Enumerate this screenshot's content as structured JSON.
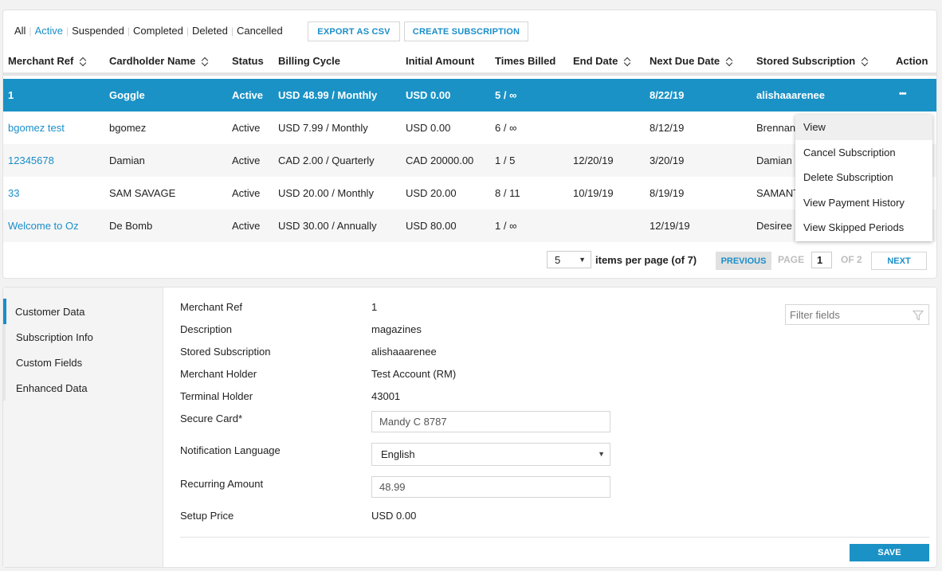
{
  "filters": [
    {
      "label": "All",
      "active": false
    },
    {
      "label": "Active",
      "active": true
    },
    {
      "label": "Suspended",
      "active": false
    },
    {
      "label": "Completed",
      "active": false
    },
    {
      "label": "Deleted",
      "active": false
    },
    {
      "label": "Cancelled",
      "active": false
    }
  ],
  "toolbar": {
    "export_label": "EXPORT AS CSV",
    "create_label": "CREATE SUBSCRIPTION"
  },
  "table": {
    "columns": [
      {
        "label": "Merchant Ref",
        "sortable": true
      },
      {
        "label": "Cardholder Name",
        "sortable": true
      },
      {
        "label": "Status",
        "sortable": false
      },
      {
        "label": "Billing Cycle",
        "sortable": false
      },
      {
        "label": "Initial Amount",
        "sortable": false
      },
      {
        "label": "Times Billed",
        "sortable": false
      },
      {
        "label": "End Date",
        "sortable": true
      },
      {
        "label": "Next Due Date",
        "sortable": true
      },
      {
        "label": "Stored Subscription",
        "sortable": true
      },
      {
        "label": "Action",
        "sortable": false
      }
    ],
    "rows": [
      {
        "merchant_ref": "1",
        "cardholder": "Goggle",
        "status": "Active",
        "billing_cycle": "USD 48.99 / Monthly",
        "initial_amount": "USD 0.00",
        "times_billed": "5 / ∞",
        "end_date": "",
        "next_due": "8/22/19",
        "stored_subscription": "alishaaarenee",
        "selected": true
      },
      {
        "merchant_ref": "bgomez test",
        "cardholder": "bgomez",
        "status": "Active",
        "billing_cycle": "USD 7.99 / Monthly",
        "initial_amount": "USD 0.00",
        "times_billed": "6 / ∞",
        "end_date": "",
        "next_due": "8/12/19",
        "stored_subscription": "Brennan"
      },
      {
        "merchant_ref": "12345678",
        "cardholder": "Damian",
        "status": "Active",
        "billing_cycle": "CAD 2.00 / Quarterly",
        "initial_amount": "CAD 20000.00",
        "times_billed": "1 / 5",
        "end_date": "12/20/19",
        "next_due": "3/20/19",
        "stored_subscription": "Damian"
      },
      {
        "merchant_ref": "33",
        "cardholder": "SAM SAVAGE",
        "status": "Active",
        "billing_cycle": "USD 20.00 / Monthly",
        "initial_amount": "USD 20.00",
        "times_billed": "8 / 11",
        "end_date": "10/19/19",
        "next_due": "8/19/19",
        "stored_subscription": "SAMANT"
      },
      {
        "merchant_ref": "Welcome to Oz",
        "cardholder": "De Bomb",
        "status": "Active",
        "billing_cycle": "USD 30.00 / Annually",
        "initial_amount": "USD 80.00",
        "times_billed": "1 / ∞",
        "end_date": "",
        "next_due": "12/19/19",
        "stored_subscription": "Desiree"
      }
    ],
    "action_icon": "more-horizontal-icon"
  },
  "action_menu": {
    "items": [
      "View",
      "Cancel Subscription",
      "Delete Subscription",
      "View Payment History",
      "View Skipped Periods"
    ],
    "hovered": "View"
  },
  "pagination": {
    "page_size": "5",
    "items_label": "items per page (of 7)",
    "previous_label": "PREVIOUS",
    "page_label": "PAGE",
    "current_page": "1",
    "of_label": "OF 2",
    "next_label": "NEXT"
  },
  "details": {
    "tabs": [
      {
        "label": "Customer Data",
        "active": true
      },
      {
        "label": "Subscription Info",
        "active": false
      },
      {
        "label": "Custom Fields",
        "active": false
      },
      {
        "label": "Enhanced Data",
        "active": false
      }
    ],
    "filter_placeholder": "Filter fields",
    "fields": {
      "merchant_ref": {
        "label": "Merchant Ref",
        "value": "1"
      },
      "description": {
        "label": "Description",
        "value": "magazines"
      },
      "stored_subscription": {
        "label": "Stored Subscription",
        "value": "alishaaarenee"
      },
      "merchant_holder": {
        "label": "Merchant Holder",
        "value": "Test Account (RM)"
      },
      "terminal_holder": {
        "label": "Terminal Holder",
        "value": "43001"
      },
      "secure_card": {
        "label": "Secure Card*",
        "value": "Mandy C 8787"
      },
      "notification_language": {
        "label": "Notification Language",
        "value": "English"
      },
      "recurring_amount": {
        "label": "Recurring Amount",
        "value": "48.99"
      },
      "setup_price": {
        "label": "Setup Price",
        "value": "USD 0.00"
      }
    },
    "save_label": "SAVE"
  },
  "colors": {
    "accent": "#1a92c6",
    "link": "#1a8ec9",
    "page_bg": "#f2f2f2"
  }
}
